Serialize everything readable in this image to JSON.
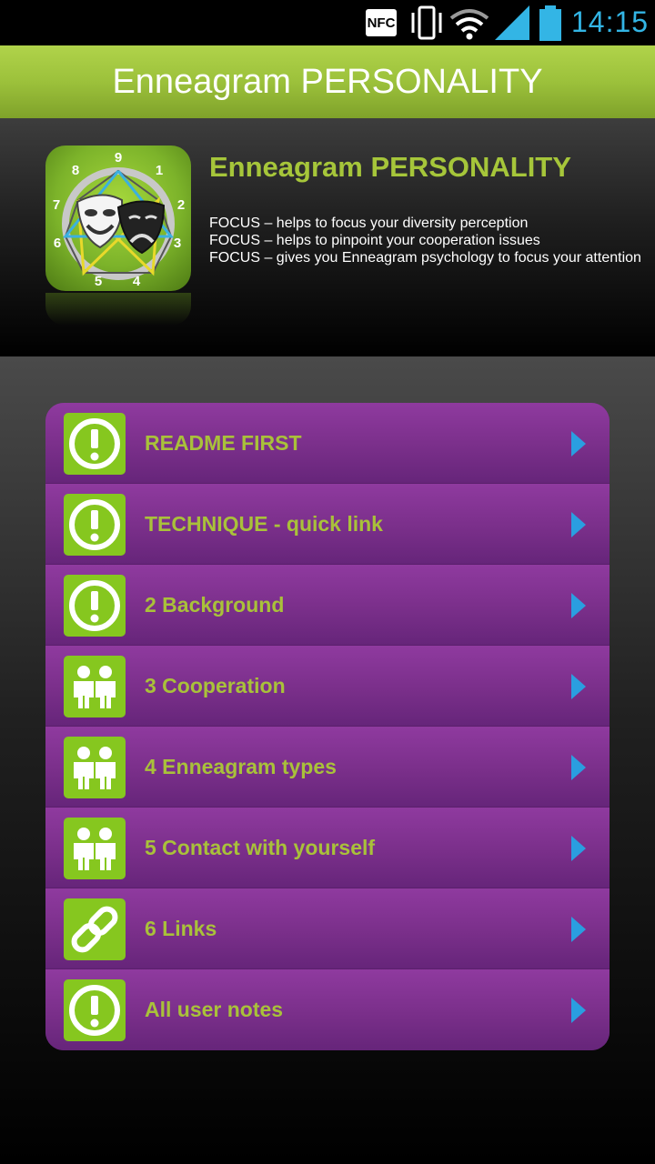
{
  "status_bar": {
    "nfc": "NFC",
    "time": "14:15",
    "icons": [
      "nfc-icon",
      "vibrate-icon",
      "wifi-icon",
      "signal-icon",
      "battery-icon"
    ]
  },
  "title_bar": {
    "title": "Enneagram PERSONALITY"
  },
  "header": {
    "app_name": "Enneagram PERSONALITY",
    "focus_lines": [
      "FOCUS – helps to focus your diversity perception",
      "FOCUS – helps to pinpoint your cooperation issues",
      "FOCUS – gives you Enneagram psychology to focus your attention"
    ],
    "icon_numbers": [
      "9",
      "1",
      "2",
      "3",
      "4",
      "5",
      "6",
      "7",
      "8"
    ]
  },
  "menu": {
    "items": [
      {
        "label": "README FIRST",
        "icon": "exclamation-icon"
      },
      {
        "label": "TECHNIQUE - quick link",
        "icon": "exclamation-icon"
      },
      {
        "label": "2 Background",
        "icon": "exclamation-icon"
      },
      {
        "label": "3 Cooperation",
        "icon": "people-icon"
      },
      {
        "label": "4 Enneagram types",
        "icon": "people-icon"
      },
      {
        "label": "5 Contact with yourself",
        "icon": "people-icon"
      },
      {
        "label": "6 Links",
        "icon": "chain-link-icon"
      },
      {
        "label": "All user notes",
        "icon": "exclamation-icon"
      }
    ]
  },
  "colors": {
    "accent_green": "#9cc13b",
    "menu_purple": "#7a2f8a",
    "label_green": "#a9c13a",
    "status_blue": "#33b5e5"
  }
}
